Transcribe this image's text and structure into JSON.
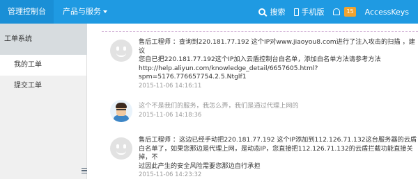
{
  "topbar": {
    "brand": "管理控制台",
    "products_menu": "产品与服务",
    "search_label": "搜索",
    "mobile_label": "手机版",
    "notification_count": "15",
    "accesskeys_label": "AccessKeys"
  },
  "sidebar": {
    "title": "工单系统",
    "items": [
      {
        "label": "我的工单"
      },
      {
        "label": "提交工单"
      }
    ]
  },
  "replies": [
    {
      "author": "售后工程师",
      "lines": [
        "售后工程师 ：查询到220.181.77.192 这个IP对www.jiaoyou8.com进行了注入攻击的扫描 ，建议",
        "您自已把220.181.77.192这个IP加入云盾控制台白名单，添加白名单方法请参考方法",
        "http://help.aliyun.com/knowledge_detail/6657605.html?",
        "spm=5176.776657754.2.5.Ntglf1"
      ],
      "time": "2015-11-06 14:16:11"
    },
    {
      "author": "user",
      "lines": [
        "这个不是我们的服务，我怎么弄，我们是通过代理上网的"
      ],
      "time": "2015-11-06 14:18:36"
    },
    {
      "author": "售后工程师",
      "lines": [
        "售后工程师 ：这边已经手动把220.181.77.192 这个IP添加到112.126.71.132这台服务器的云盾",
        "白名单了，如果您那边是代理上网，是动态IP，您直接把112.126.71.132的云盾拦截功能直接关掉，不",
        "过因此产生的安全风险需要您那边自行承担"
      ],
      "time": "2015-11-06 14:23:32"
    }
  ]
}
